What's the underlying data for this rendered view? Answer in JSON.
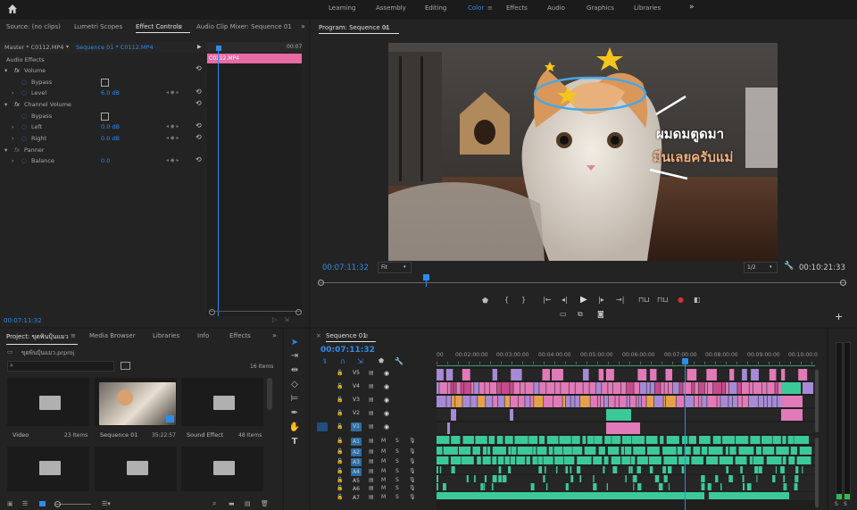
{
  "workspaces": [
    "Learning",
    "Assembly",
    "Editing",
    "Color",
    "Effects",
    "Audio",
    "Graphics",
    "Libraries"
  ],
  "active_workspace": "Color",
  "top_panel_tabs": {
    "source": "Source: (no clips)",
    "lumetri": "Lumetri Scopes",
    "effect_controls": "Effect Controls",
    "audio_mixer": "Audio Clip Mixer: Sequence 01"
  },
  "effect_controls": {
    "master": "Master * C0112.MP4",
    "sequence": "Sequence 01 * C0112.MP4",
    "ruler_time": "00:07",
    "clip_name": "C0112.MP4",
    "section": "Audio Effects",
    "rows": [
      {
        "type": "fx",
        "label": "Volume"
      },
      {
        "type": "param",
        "label": "Bypass",
        "value": ""
      },
      {
        "type": "param",
        "label": "Level",
        "value": "6.0 dB"
      },
      {
        "type": "fx",
        "label": "Channel Volume"
      },
      {
        "type": "param",
        "label": "Bypass",
        "value": ""
      },
      {
        "type": "param",
        "label": "Left",
        "value": "0.0 dB"
      },
      {
        "type": "param",
        "label": "Right",
        "value": "0.0 dB"
      },
      {
        "type": "fx",
        "label": "Panner"
      },
      {
        "type": "param",
        "label": "Balance",
        "value": "0.0"
      }
    ],
    "timecode": "00:07:11:32"
  },
  "program": {
    "title": "Program: Sequence 01",
    "overlay_line1": "ผมดมตูดมา",
    "overlay_line2": "มีนเลยครับแม่",
    "timecode": "00:07:11:32",
    "fit": "Fit",
    "resolution": "1/2",
    "duration": "00:10:21:33",
    "playhead_fraction": 0.2
  },
  "project": {
    "tabs": [
      "Project: ขุดพินปุ้นแมว",
      "Media Browser",
      "Libraries",
      "Info",
      "Effects"
    ],
    "file": "ขุดพินปุ้นแมว.prproj",
    "item_count": "16 Items",
    "items": [
      {
        "name": "Video",
        "meta": "23 Items",
        "kind": "folder"
      },
      {
        "name": "Sequence 01",
        "meta": "35:22:57",
        "kind": "sequence"
      },
      {
        "name": "Sound Effect",
        "meta": "48 Items",
        "kind": "folder"
      },
      {
        "name": "",
        "meta": "",
        "kind": "folder"
      },
      {
        "name": "",
        "meta": "",
        "kind": "folder"
      },
      {
        "name": "",
        "meta": "",
        "kind": "folder"
      }
    ]
  },
  "timeline": {
    "tab": "Sequence 01",
    "timecode": "00:07:11:32",
    "ruler": [
      "00",
      "00:02:00:00",
      "00:03:00:00",
      "00:04:00:00",
      "00:05:00:00",
      "00:06:00:00",
      "00:07:00:00",
      "00:08:00:00",
      "00:09:00:00",
      "00:10:00:0"
    ],
    "video_tracks": [
      "V5",
      "V4",
      "V3",
      "V2",
      "V1"
    ],
    "audio_tracks": [
      "A1",
      "A2",
      "A3",
      "A4",
      "A5",
      "A6",
      "A7"
    ]
  },
  "colors": {
    "accent": "#2d8ceb",
    "clip_pink": "#e17ab8",
    "clip_violet": "#a78ad6",
    "audio_green": "#3cc99a",
    "clip_orange": "#e4a14a"
  }
}
